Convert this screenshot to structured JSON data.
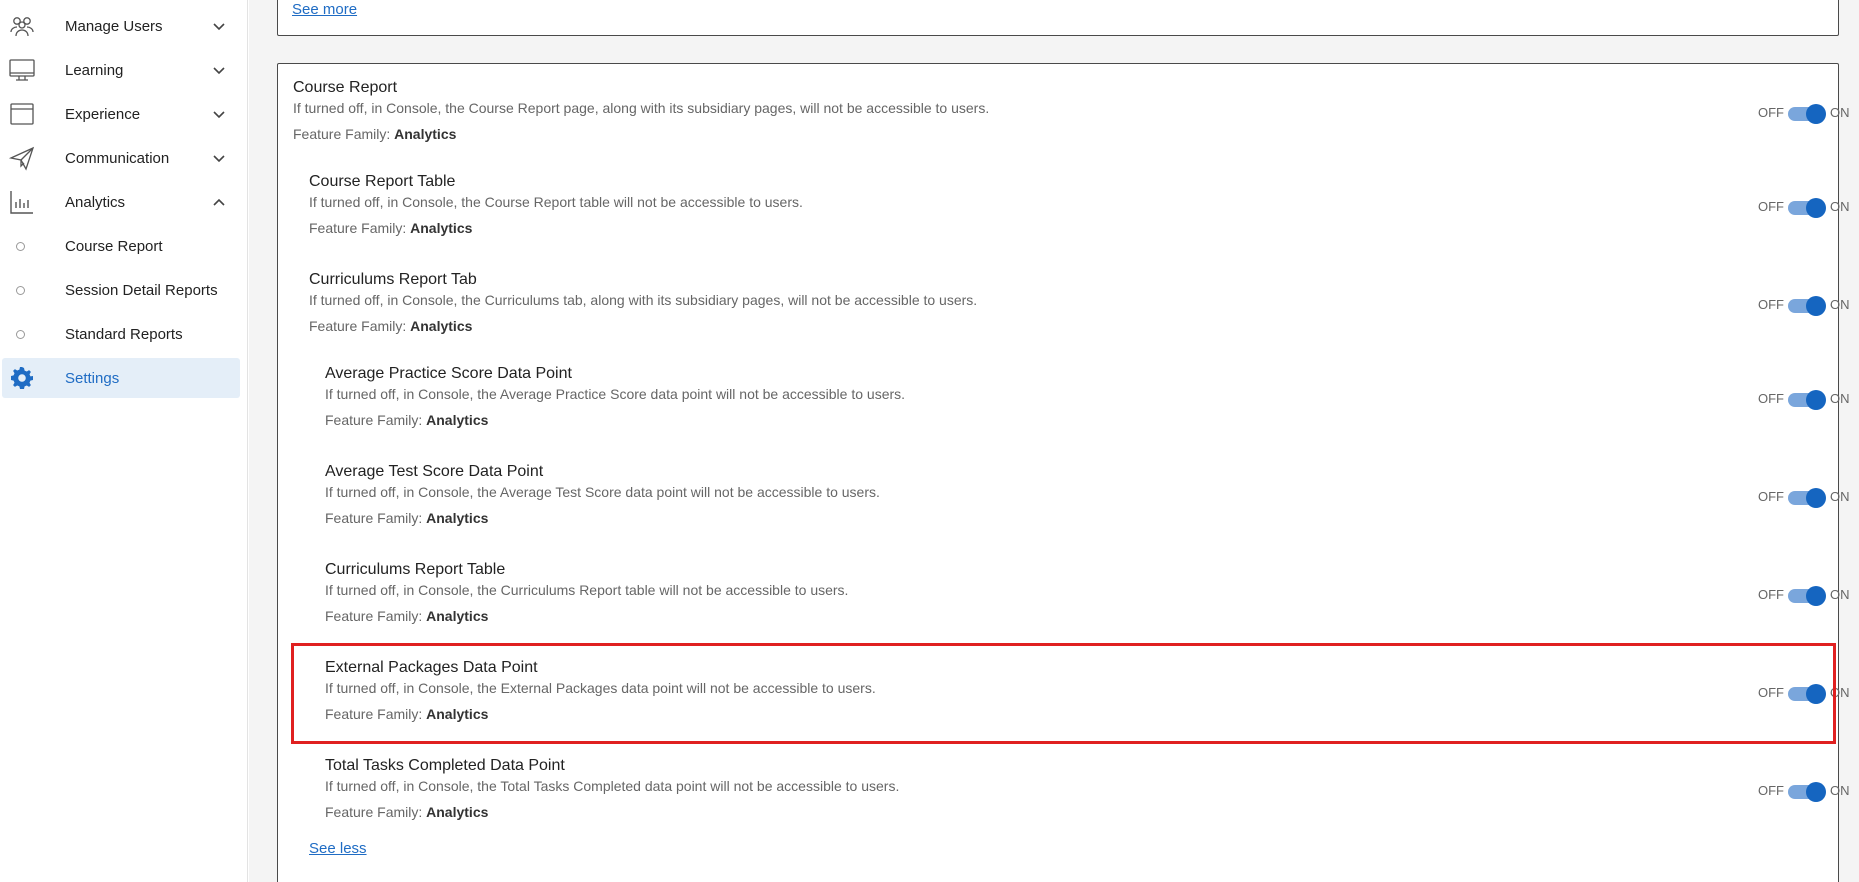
{
  "sidebar": {
    "items": [
      {
        "label": "Manage Users",
        "icon": "users-icon"
      },
      {
        "label": "Learning",
        "icon": "monitor-icon"
      },
      {
        "label": "Experience",
        "icon": "window-icon"
      },
      {
        "label": "Communication",
        "icon": "paper-plane-icon"
      },
      {
        "label": "Analytics",
        "icon": "bar-chart-icon"
      }
    ],
    "subitems": [
      {
        "label": "Course Report"
      },
      {
        "label": "Session Detail Reports"
      },
      {
        "label": "Standard Reports"
      }
    ],
    "settings": {
      "label": "Settings",
      "icon": "gear-icon"
    }
  },
  "main": {
    "see_more": "See more",
    "see_less": "See less",
    "family_label": "Feature Family:",
    "toggle_off": "OFF",
    "toggle_on": "ON",
    "features": [
      {
        "title": "Course Report",
        "desc": "If turned off, in Console, the Course Report page, along with its subsidiary pages, will not be accessible to users.",
        "family": "Analytics",
        "state": "on"
      },
      {
        "title": "Course Report Table",
        "desc": "If turned off, in Console, the Course Report table will not be accessible to users.",
        "family": "Analytics",
        "state": "on"
      },
      {
        "title": "Curriculums Report Tab",
        "desc": "If turned off, in Console, the Curriculums tab, along with its subsidiary pages, will not be accessible to users.",
        "family": "Analytics",
        "state": "on"
      },
      {
        "title": "Average Practice Score Data Point",
        "desc": "If turned off, in Console, the Average Practice Score data point will not be accessible to users.",
        "family": "Analytics",
        "state": "on"
      },
      {
        "title": "Average Test Score Data Point",
        "desc": "If turned off, in Console, the Average Test Score data point will not be accessible to users.",
        "family": "Analytics",
        "state": "on"
      },
      {
        "title": "Curriculums Report Table",
        "desc": "If turned off, in Console, the Curriculums Report table will not be accessible to users.",
        "family": "Analytics",
        "state": "on"
      },
      {
        "title": "External Packages Data Point",
        "desc": "If turned off, in Console, the External Packages data point will not be accessible to users.",
        "family": "Analytics",
        "state": "on"
      },
      {
        "title": "Total Tasks Completed Data Point",
        "desc": "If turned off, in Console, the Total Tasks Completed data point will not be accessible to users.",
        "family": "Analytics",
        "state": "on"
      }
    ]
  }
}
